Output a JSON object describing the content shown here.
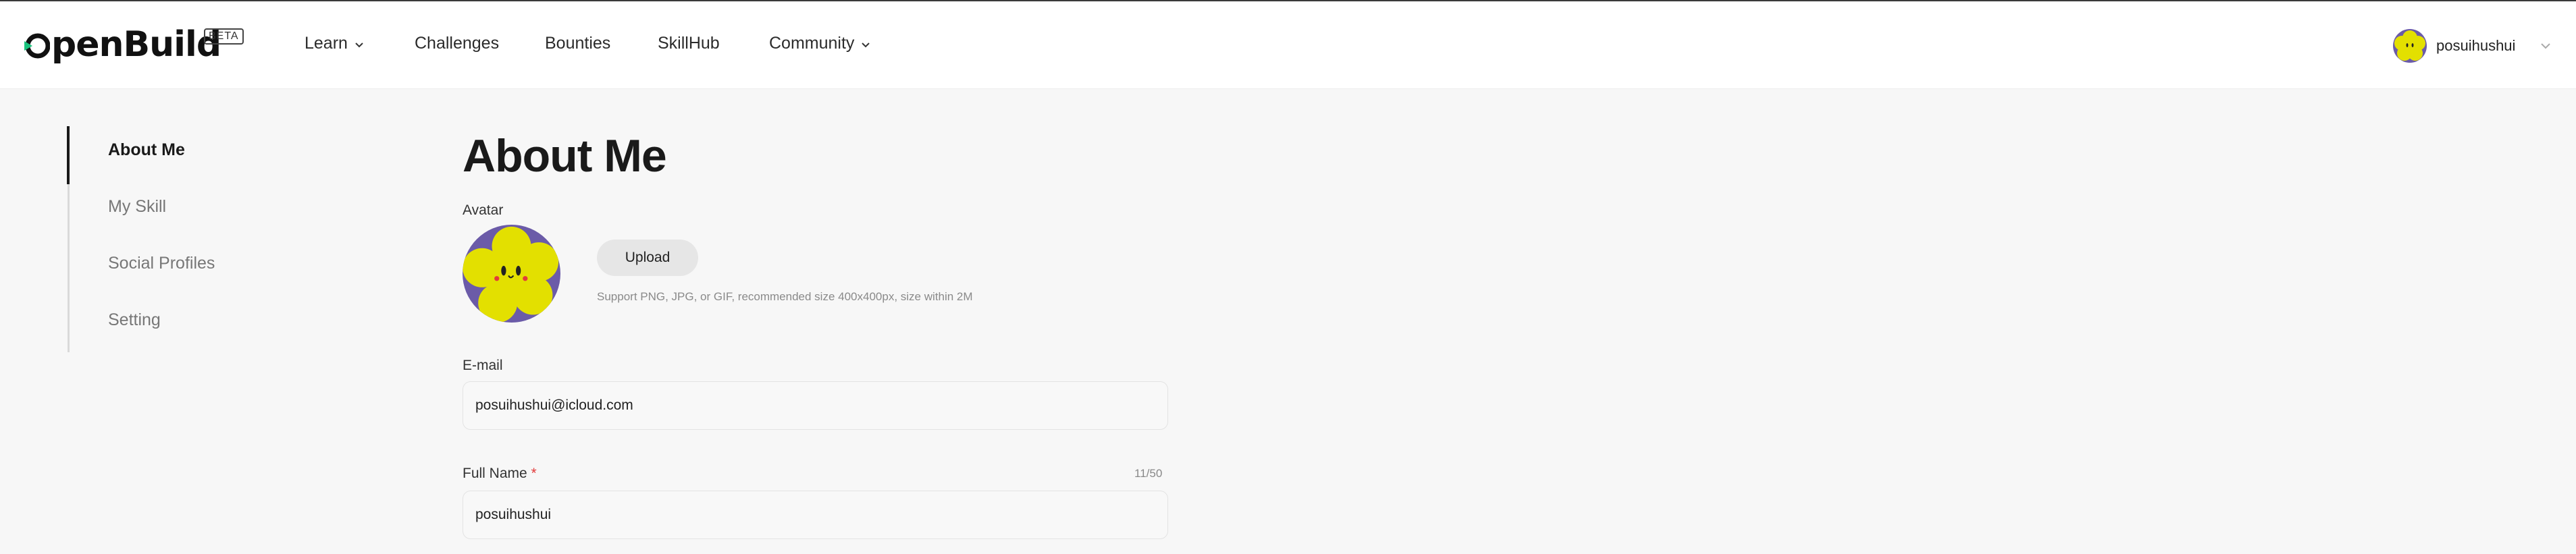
{
  "header": {
    "logo_text": "penBuild",
    "beta_label": "BETA",
    "nav": [
      {
        "label": "Learn",
        "has_dropdown": true
      },
      {
        "label": "Challenges",
        "has_dropdown": false
      },
      {
        "label": "Bounties",
        "has_dropdown": false
      },
      {
        "label": "SkillHub",
        "has_dropdown": false
      },
      {
        "label": "Community",
        "has_dropdown": true
      }
    ],
    "user_name": "posuihushui"
  },
  "sidebar": {
    "items": [
      {
        "label": "About Me",
        "active": true
      },
      {
        "label": "My Skill",
        "active": false
      },
      {
        "label": "Social Profiles",
        "active": false
      },
      {
        "label": "Setting",
        "active": false
      }
    ]
  },
  "main": {
    "title": "About Me",
    "avatar_label": "Avatar",
    "upload_label": "Upload",
    "upload_hint": "Support PNG, JPG, or GIF, recommended size 400x400px, size within 2M",
    "email_label": "E-mail",
    "email_value": "posuihushui@icloud.com",
    "fullname_label": "Full Name",
    "fullname_required_mark": "*",
    "fullname_value": "posuihushui",
    "fullname_counter": "11/50"
  },
  "colors": {
    "brand_accent": "#19c37d",
    "avatar_bg": "#6b5ba8",
    "avatar_flower": "#e3e000",
    "required": "#e23b3b"
  },
  "icons": [
    "chevron-down-icon",
    "openbuild-logo-icon",
    "user-avatar-icon",
    "flower-avatar-icon"
  ]
}
